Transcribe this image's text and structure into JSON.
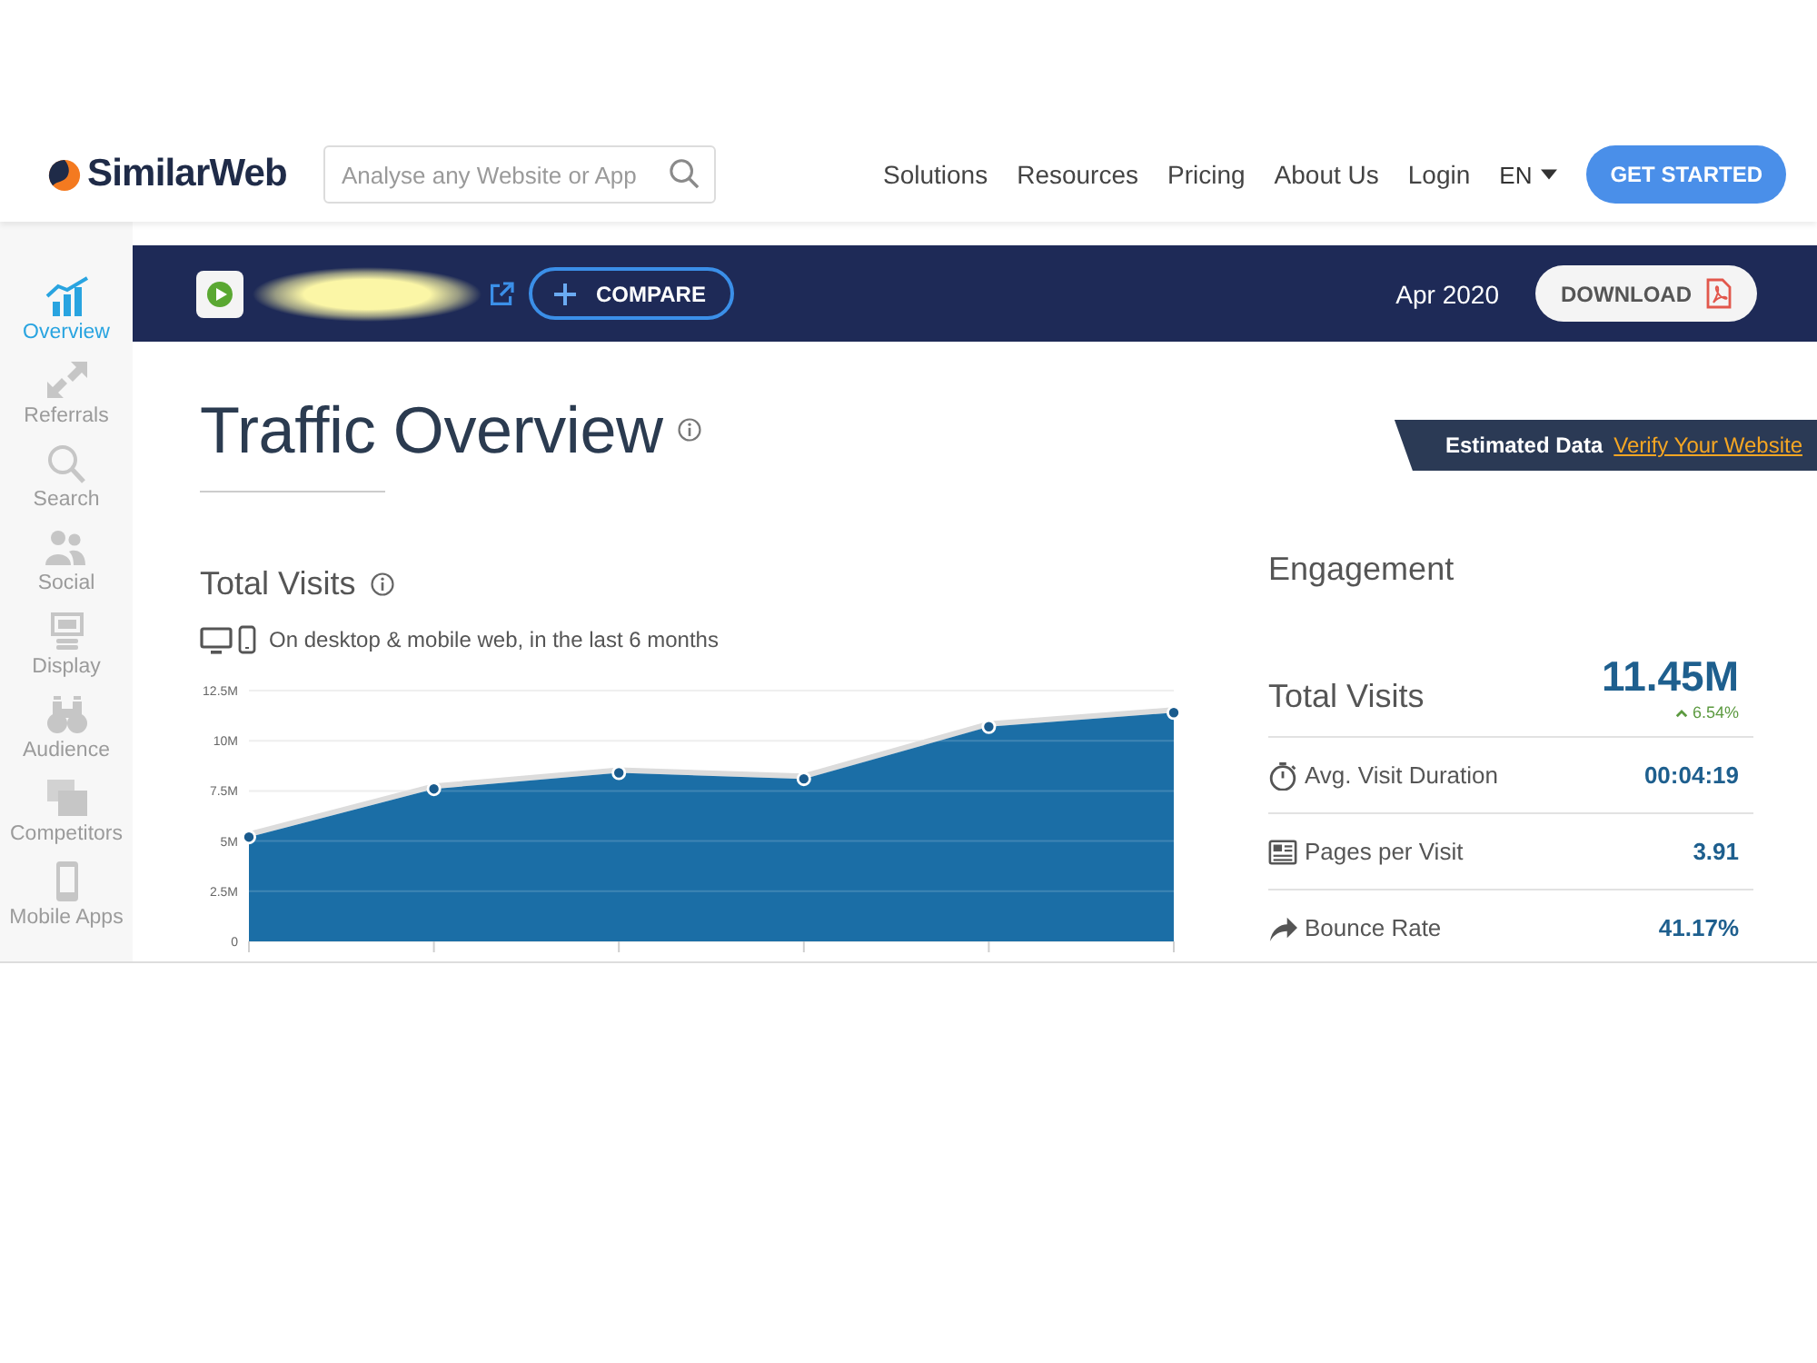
{
  "header": {
    "logo": "SimilarWeb",
    "search": {
      "placeholder": "Analyse any Website or App"
    },
    "nav": [
      "Solutions",
      "Resources",
      "Pricing",
      "About Us",
      "Login"
    ],
    "language": "EN",
    "cta": "GET STARTED"
  },
  "sidebar": {
    "items": [
      {
        "label": "Overview",
        "selected": true
      },
      {
        "label": "Referrals",
        "selected": false
      },
      {
        "label": "Search",
        "selected": false
      },
      {
        "label": "Social",
        "selected": false
      },
      {
        "label": "Display",
        "selected": false
      },
      {
        "label": "Audience",
        "selected": false
      },
      {
        "label": "Competitors",
        "selected": false
      },
      {
        "label": "Mobile Apps",
        "selected": false
      }
    ]
  },
  "site_bar": {
    "compare": "COMPARE",
    "date": "Apr 2020",
    "download": "DOWNLOAD"
  },
  "page_title": "Traffic Overview",
  "estimated_banner": {
    "label": "Estimated Data",
    "link": "Verify Your Website"
  },
  "total_visits": {
    "title": "Total Visits",
    "subtitle": "On desktop & mobile web, in the last 6 months",
    "chart_data": {
      "type": "area",
      "grid": true,
      "series": [
        {
          "color": "#1b6ea6",
          "values": [
            5.2,
            7.6,
            8.4,
            8.1,
            10.7,
            11.4
          ]
        }
      ],
      "ylim": [
        0,
        12.5
      ],
      "yticks": [
        0,
        {
          "value": 2.5,
          "label": "2.5M"
        },
        {
          "value": 5,
          "label": "5M"
        },
        {
          "value": 7.5,
          "label": "7.5M"
        },
        {
          "value": 10,
          "label": "10M"
        },
        {
          "value": 12.5,
          "label": "12.5M"
        }
      ]
    }
  },
  "engagement": {
    "title": "Engagement",
    "total": {
      "label": "Total Visits",
      "value": "11.45M",
      "change": "6.54%",
      "increase": true
    },
    "metrics": [
      {
        "label": "Avg. Visit Duration",
        "value": "00:04:19"
      },
      {
        "label": "Pages per Visit",
        "value": "3.91"
      },
      {
        "label": "Bounce Rate",
        "value": "41.17%"
      }
    ]
  }
}
